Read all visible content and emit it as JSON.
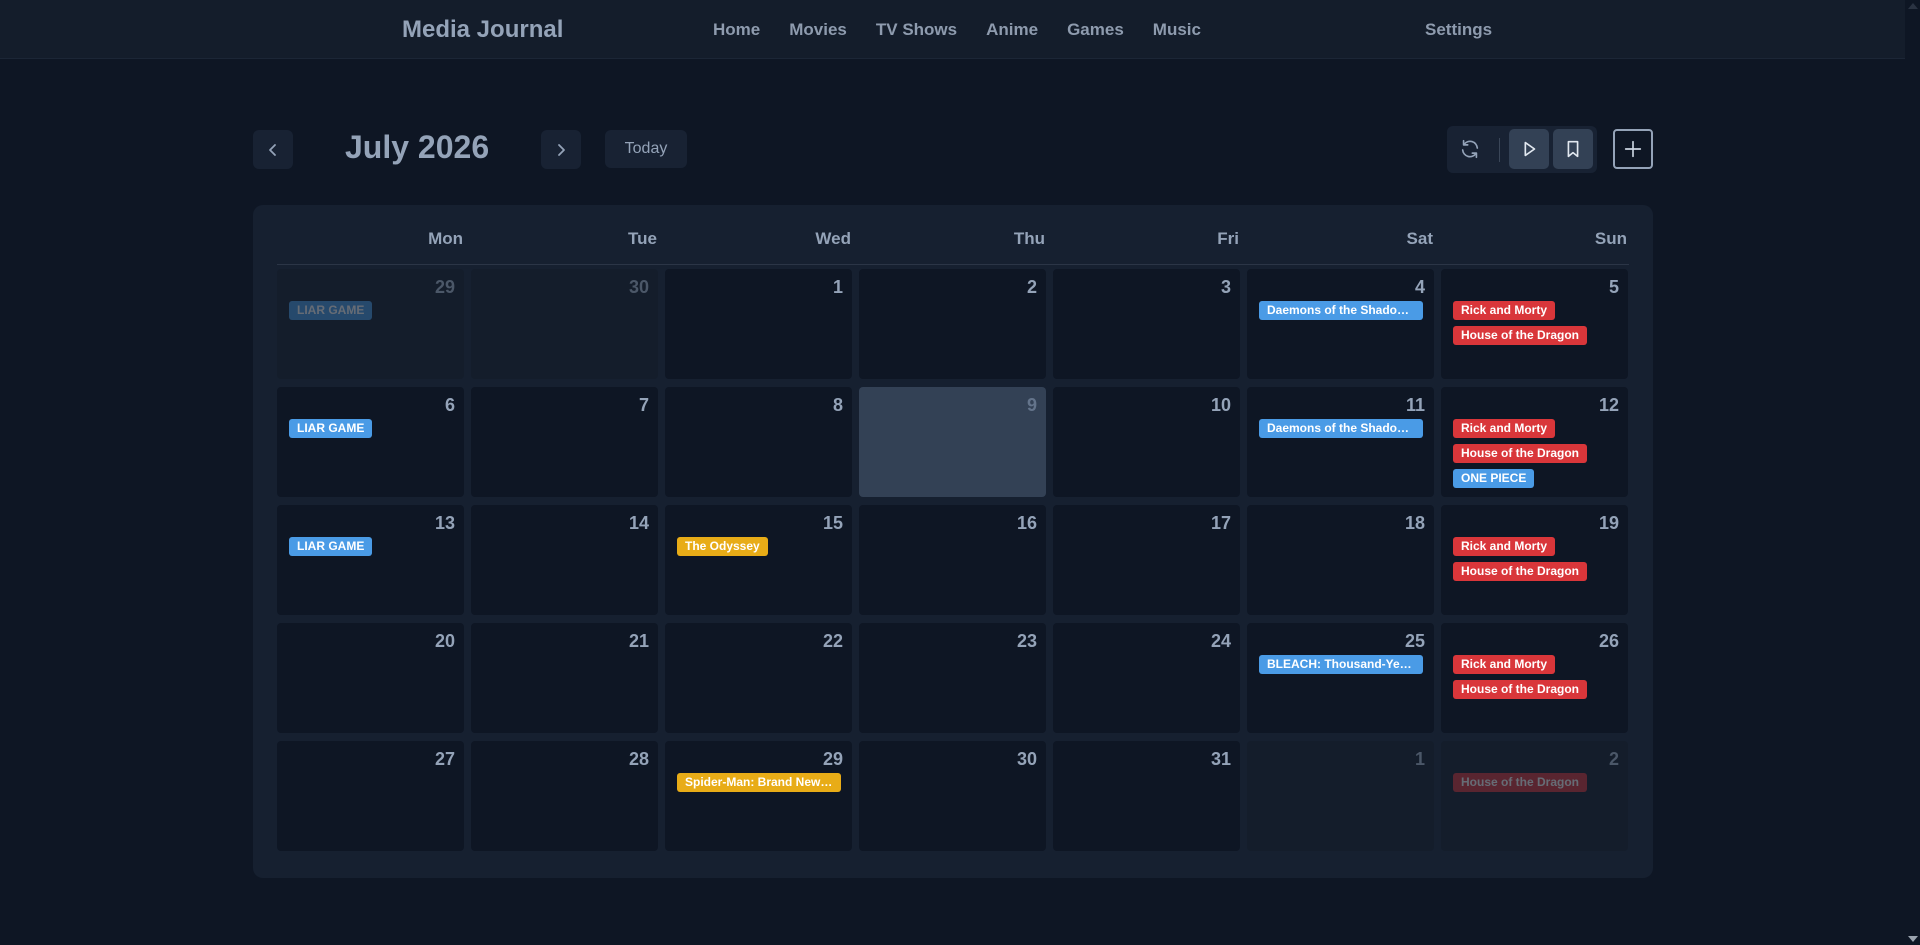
{
  "app": {
    "title": "Media Journal",
    "nav": [
      "Home",
      "Movies",
      "TV Shows",
      "Anime",
      "Games",
      "Music"
    ],
    "settings": "Settings"
  },
  "toolbar": {
    "month_label": "July 2026",
    "today_label": "Today",
    "icons": {
      "prev": "chevron-left-icon",
      "next": "chevron-right-icon",
      "refresh": "refresh-icon",
      "play": "play-icon",
      "bookmark": "bookmark-icon",
      "add": "plus-icon"
    }
  },
  "colors": {
    "background": "#0e1624",
    "panel": "#162030",
    "event_blue": "#4a9be6",
    "event_red": "#d9363a",
    "event_yellow": "#e8ac17",
    "today_cell": "#334155"
  },
  "calendar": {
    "weekdays": [
      "Mon",
      "Tue",
      "Wed",
      "Thu",
      "Fri",
      "Sat",
      "Sun"
    ],
    "weeks": [
      [
        {
          "day": "29",
          "other": true,
          "events": [
            {
              "title": "LIAR GAME",
              "color": "blue"
            }
          ]
        },
        {
          "day": "30",
          "other": true,
          "events": []
        },
        {
          "day": "1",
          "events": []
        },
        {
          "day": "2",
          "events": []
        },
        {
          "day": "3",
          "events": []
        },
        {
          "day": "4",
          "events": [
            {
              "title": "Daemons of the Shadow Realm",
              "color": "blue",
              "wide": true
            }
          ]
        },
        {
          "day": "5",
          "events": [
            {
              "title": "Rick and Morty",
              "color": "red"
            },
            {
              "title": "House of the Dragon",
              "color": "red"
            }
          ]
        }
      ],
      [
        {
          "day": "6",
          "events": [
            {
              "title": "LIAR GAME",
              "color": "blue"
            }
          ]
        },
        {
          "day": "7",
          "events": []
        },
        {
          "day": "8",
          "events": []
        },
        {
          "day": "9",
          "today": true,
          "events": []
        },
        {
          "day": "10",
          "events": []
        },
        {
          "day": "11",
          "events": [
            {
              "title": "Daemons of the Shadow Realm",
              "color": "blue",
              "wide": true
            }
          ]
        },
        {
          "day": "12",
          "events": [
            {
              "title": "Rick and Morty",
              "color": "red"
            },
            {
              "title": "House of the Dragon",
              "color": "red"
            },
            {
              "title": "ONE PIECE",
              "color": "blue"
            }
          ]
        }
      ],
      [
        {
          "day": "13",
          "events": [
            {
              "title": "LIAR GAME",
              "color": "blue"
            }
          ]
        },
        {
          "day": "14",
          "events": []
        },
        {
          "day": "15",
          "events": [
            {
              "title": "The Odyssey",
              "color": "yellow"
            }
          ]
        },
        {
          "day": "16",
          "events": []
        },
        {
          "day": "17",
          "events": []
        },
        {
          "day": "18",
          "events": []
        },
        {
          "day": "19",
          "events": [
            {
              "title": "Rick and Morty",
              "color": "red"
            },
            {
              "title": "House of the Dragon",
              "color": "red"
            }
          ]
        }
      ],
      [
        {
          "day": "20",
          "events": []
        },
        {
          "day": "21",
          "events": []
        },
        {
          "day": "22",
          "events": []
        },
        {
          "day": "23",
          "events": []
        },
        {
          "day": "24",
          "events": []
        },
        {
          "day": "25",
          "events": [
            {
              "title": "BLEACH: Thousand-Year Blood War",
              "color": "blue",
              "wide": true
            }
          ]
        },
        {
          "day": "26",
          "events": [
            {
              "title": "Rick and Morty",
              "color": "red"
            },
            {
              "title": "House of the Dragon",
              "color": "red"
            }
          ]
        }
      ],
      [
        {
          "day": "27",
          "events": []
        },
        {
          "day": "28",
          "events": []
        },
        {
          "day": "29",
          "events": [
            {
              "title": "Spider-Man: Brand New Day",
              "color": "yellow",
              "wide": true
            }
          ]
        },
        {
          "day": "30",
          "events": []
        },
        {
          "day": "31",
          "events": []
        },
        {
          "day": "1",
          "other": true,
          "events": []
        },
        {
          "day": "2",
          "other": true,
          "events": [
            {
              "title": "House of the Dragon",
              "color": "red"
            }
          ]
        }
      ]
    ]
  }
}
